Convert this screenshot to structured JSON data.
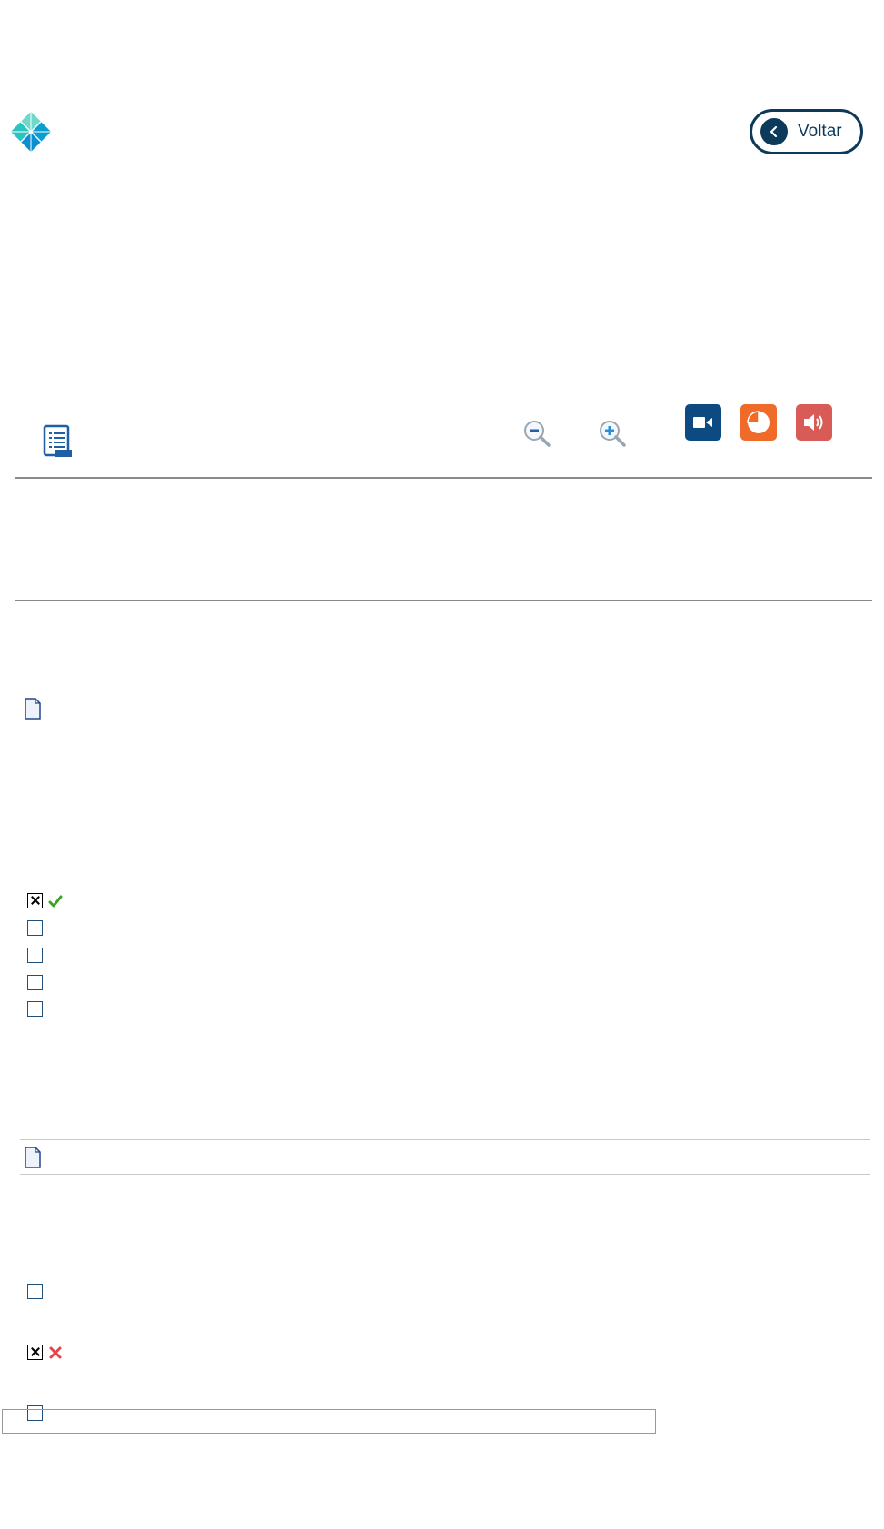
{
  "header": {
    "logo_icon": "diamond-logo",
    "back_button": {
      "label": "Voltar",
      "icon": "chevron-left-icon"
    }
  },
  "toolbar": {
    "menu_icon": "list-document-icon",
    "zoom_out_icon": "zoom-out-icon",
    "zoom_in_icon": "zoom-in-icon",
    "video_icon": "video-camera-icon",
    "chart_icon": "pie-chart-icon",
    "audio_icon": "speaker-icon",
    "colors": {
      "video": "#0d4a82",
      "chart": "#f06a2a",
      "audio": "#d95b57",
      "accent": "#0b3a5a"
    }
  },
  "questions": [
    {
      "doc_icon": "document-icon",
      "options": [
        {
          "checked": true,
          "result": "correct"
        },
        {
          "checked": false
        },
        {
          "checked": false
        },
        {
          "checked": false
        },
        {
          "checked": false
        }
      ]
    },
    {
      "doc_icon": "document-icon",
      "options": [
        {
          "checked": false
        },
        {
          "checked": true,
          "result": "incorrect"
        },
        {
          "checked": false
        }
      ]
    }
  ]
}
